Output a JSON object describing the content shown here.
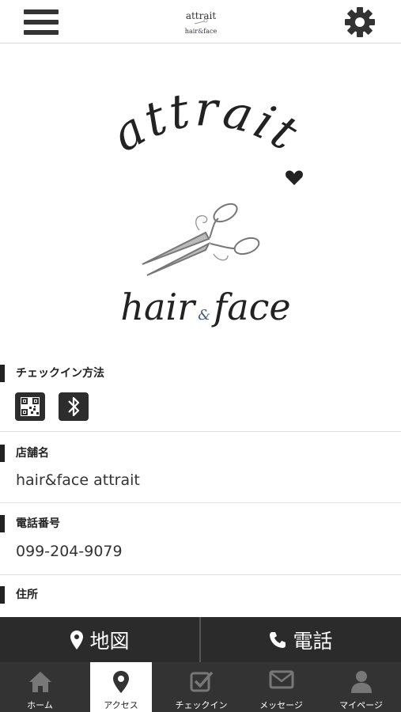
{
  "header": {
    "logo_text": "attrait hair&face"
  },
  "logo": {
    "word_top": "attrait",
    "word_hair": "hair",
    "word_amp": "&",
    "word_face": "face"
  },
  "sections": {
    "checkin": {
      "label": "チェックイン方法",
      "methods": [
        "qr-code",
        "bluetooth"
      ]
    },
    "shop": {
      "label": "店舗名",
      "value": "hair&face attrait"
    },
    "phone": {
      "label": "電話番号",
      "value": "099-204-9079"
    },
    "address": {
      "label": "住所"
    }
  },
  "action_bar": {
    "map_label": "地図",
    "tel_label": "電話"
  },
  "tabs": [
    {
      "label": "ホーム",
      "icon": "home-icon"
    },
    {
      "label": "アクセス",
      "icon": "map-pin-icon",
      "active": true
    },
    {
      "label": "チェックイン",
      "icon": "checkin-icon"
    },
    {
      "label": "メッセージ",
      "icon": "mail-icon"
    },
    {
      "label": "マイページ",
      "icon": "user-icon"
    }
  ],
  "colors": {
    "dark_bar": "#2b2b2b",
    "tab_bar": "#333333",
    "active_tab": "#ffffff",
    "text": "#222222"
  }
}
